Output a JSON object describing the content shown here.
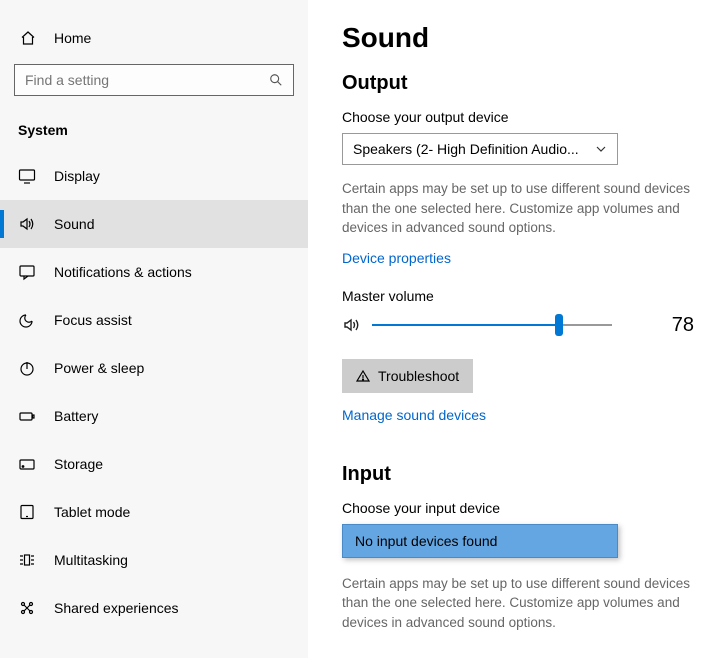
{
  "sidebar": {
    "home_label": "Home",
    "search_placeholder": "Find a setting",
    "category": "System",
    "items": [
      {
        "label": "Display"
      },
      {
        "label": "Sound"
      },
      {
        "label": "Notifications & actions"
      },
      {
        "label": "Focus assist"
      },
      {
        "label": "Power & sleep"
      },
      {
        "label": "Battery"
      },
      {
        "label": "Storage"
      },
      {
        "label": "Tablet mode"
      },
      {
        "label": "Multitasking"
      },
      {
        "label": "Shared experiences"
      }
    ]
  },
  "main": {
    "title": "Sound",
    "output": {
      "heading": "Output",
      "choose_label": "Choose your output device",
      "device": "Speakers (2- High Definition Audio...",
      "help": "Certain apps may be set up to use different sound devices than the one selected here. Customize app volumes and devices in advanced sound options.",
      "device_properties": "Device properties",
      "master_volume_label": "Master volume",
      "volume": 78,
      "troubleshoot": "Troubleshoot",
      "manage": "Manage sound devices"
    },
    "input": {
      "heading": "Input",
      "choose_label": "Choose your input device",
      "device": "No input devices found",
      "help": "Certain apps may be set up to use different sound devices than the one selected here. Customize app volumes and devices in advanced sound options."
    }
  }
}
